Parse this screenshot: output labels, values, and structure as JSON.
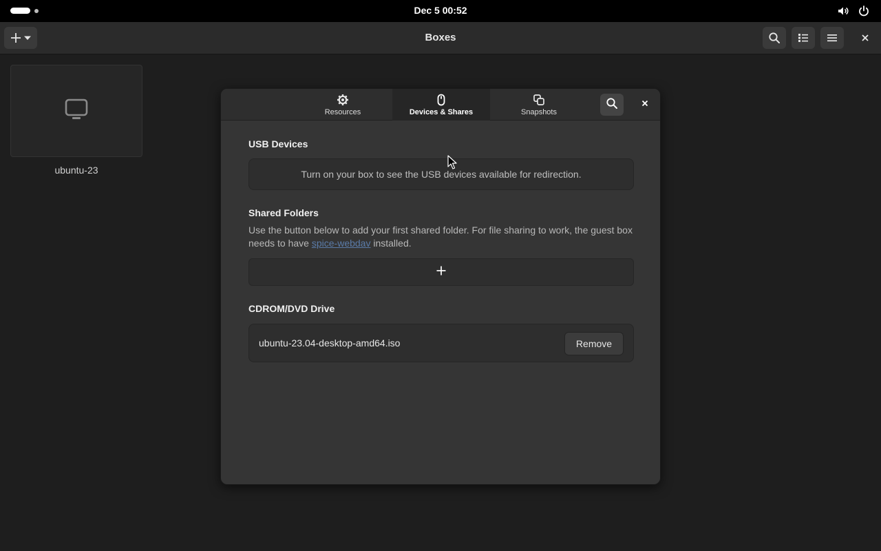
{
  "topbar": {
    "clock": "Dec 5  00:52",
    "icons": [
      "volume-icon",
      "power-icon"
    ]
  },
  "headerbar": {
    "title": "Boxes",
    "buttons": [
      "add-icon",
      "chevron-down-icon",
      "search-icon",
      "view-list-icon",
      "menu-icon",
      "close-icon"
    ]
  },
  "library": {
    "boxes": [
      {
        "name": "ubuntu-23",
        "icon": "computer-icon"
      }
    ]
  },
  "dialog": {
    "tabs": [
      {
        "label": "Resources",
        "icon": "gear-icon",
        "active": false
      },
      {
        "label": "Devices & Shares",
        "icon": "mouse-icon",
        "active": true
      },
      {
        "label": "Snapshots",
        "icon": "snapshots-icon",
        "active": false
      }
    ],
    "usb": {
      "title": "USB Devices",
      "message": "Turn on your box to see the USB devices available for redirection."
    },
    "shared": {
      "title": "Shared Folders",
      "desc_before": "Use the button below to add your first shared folder. For file sharing to work, the guest box needs to have ",
      "link": "spice-webdav",
      "desc_after": " installed."
    },
    "cdrom": {
      "title": "CDROM/DVD Drive",
      "file": "ubuntu-23.04-desktop-amd64.iso",
      "remove_label": "Remove"
    }
  },
  "colors": {
    "background": "#1e1e1e",
    "topbar": "#000000",
    "headerbar": "#2b2b2b",
    "dialog": "#353535",
    "link": "#5a7ba8"
  }
}
